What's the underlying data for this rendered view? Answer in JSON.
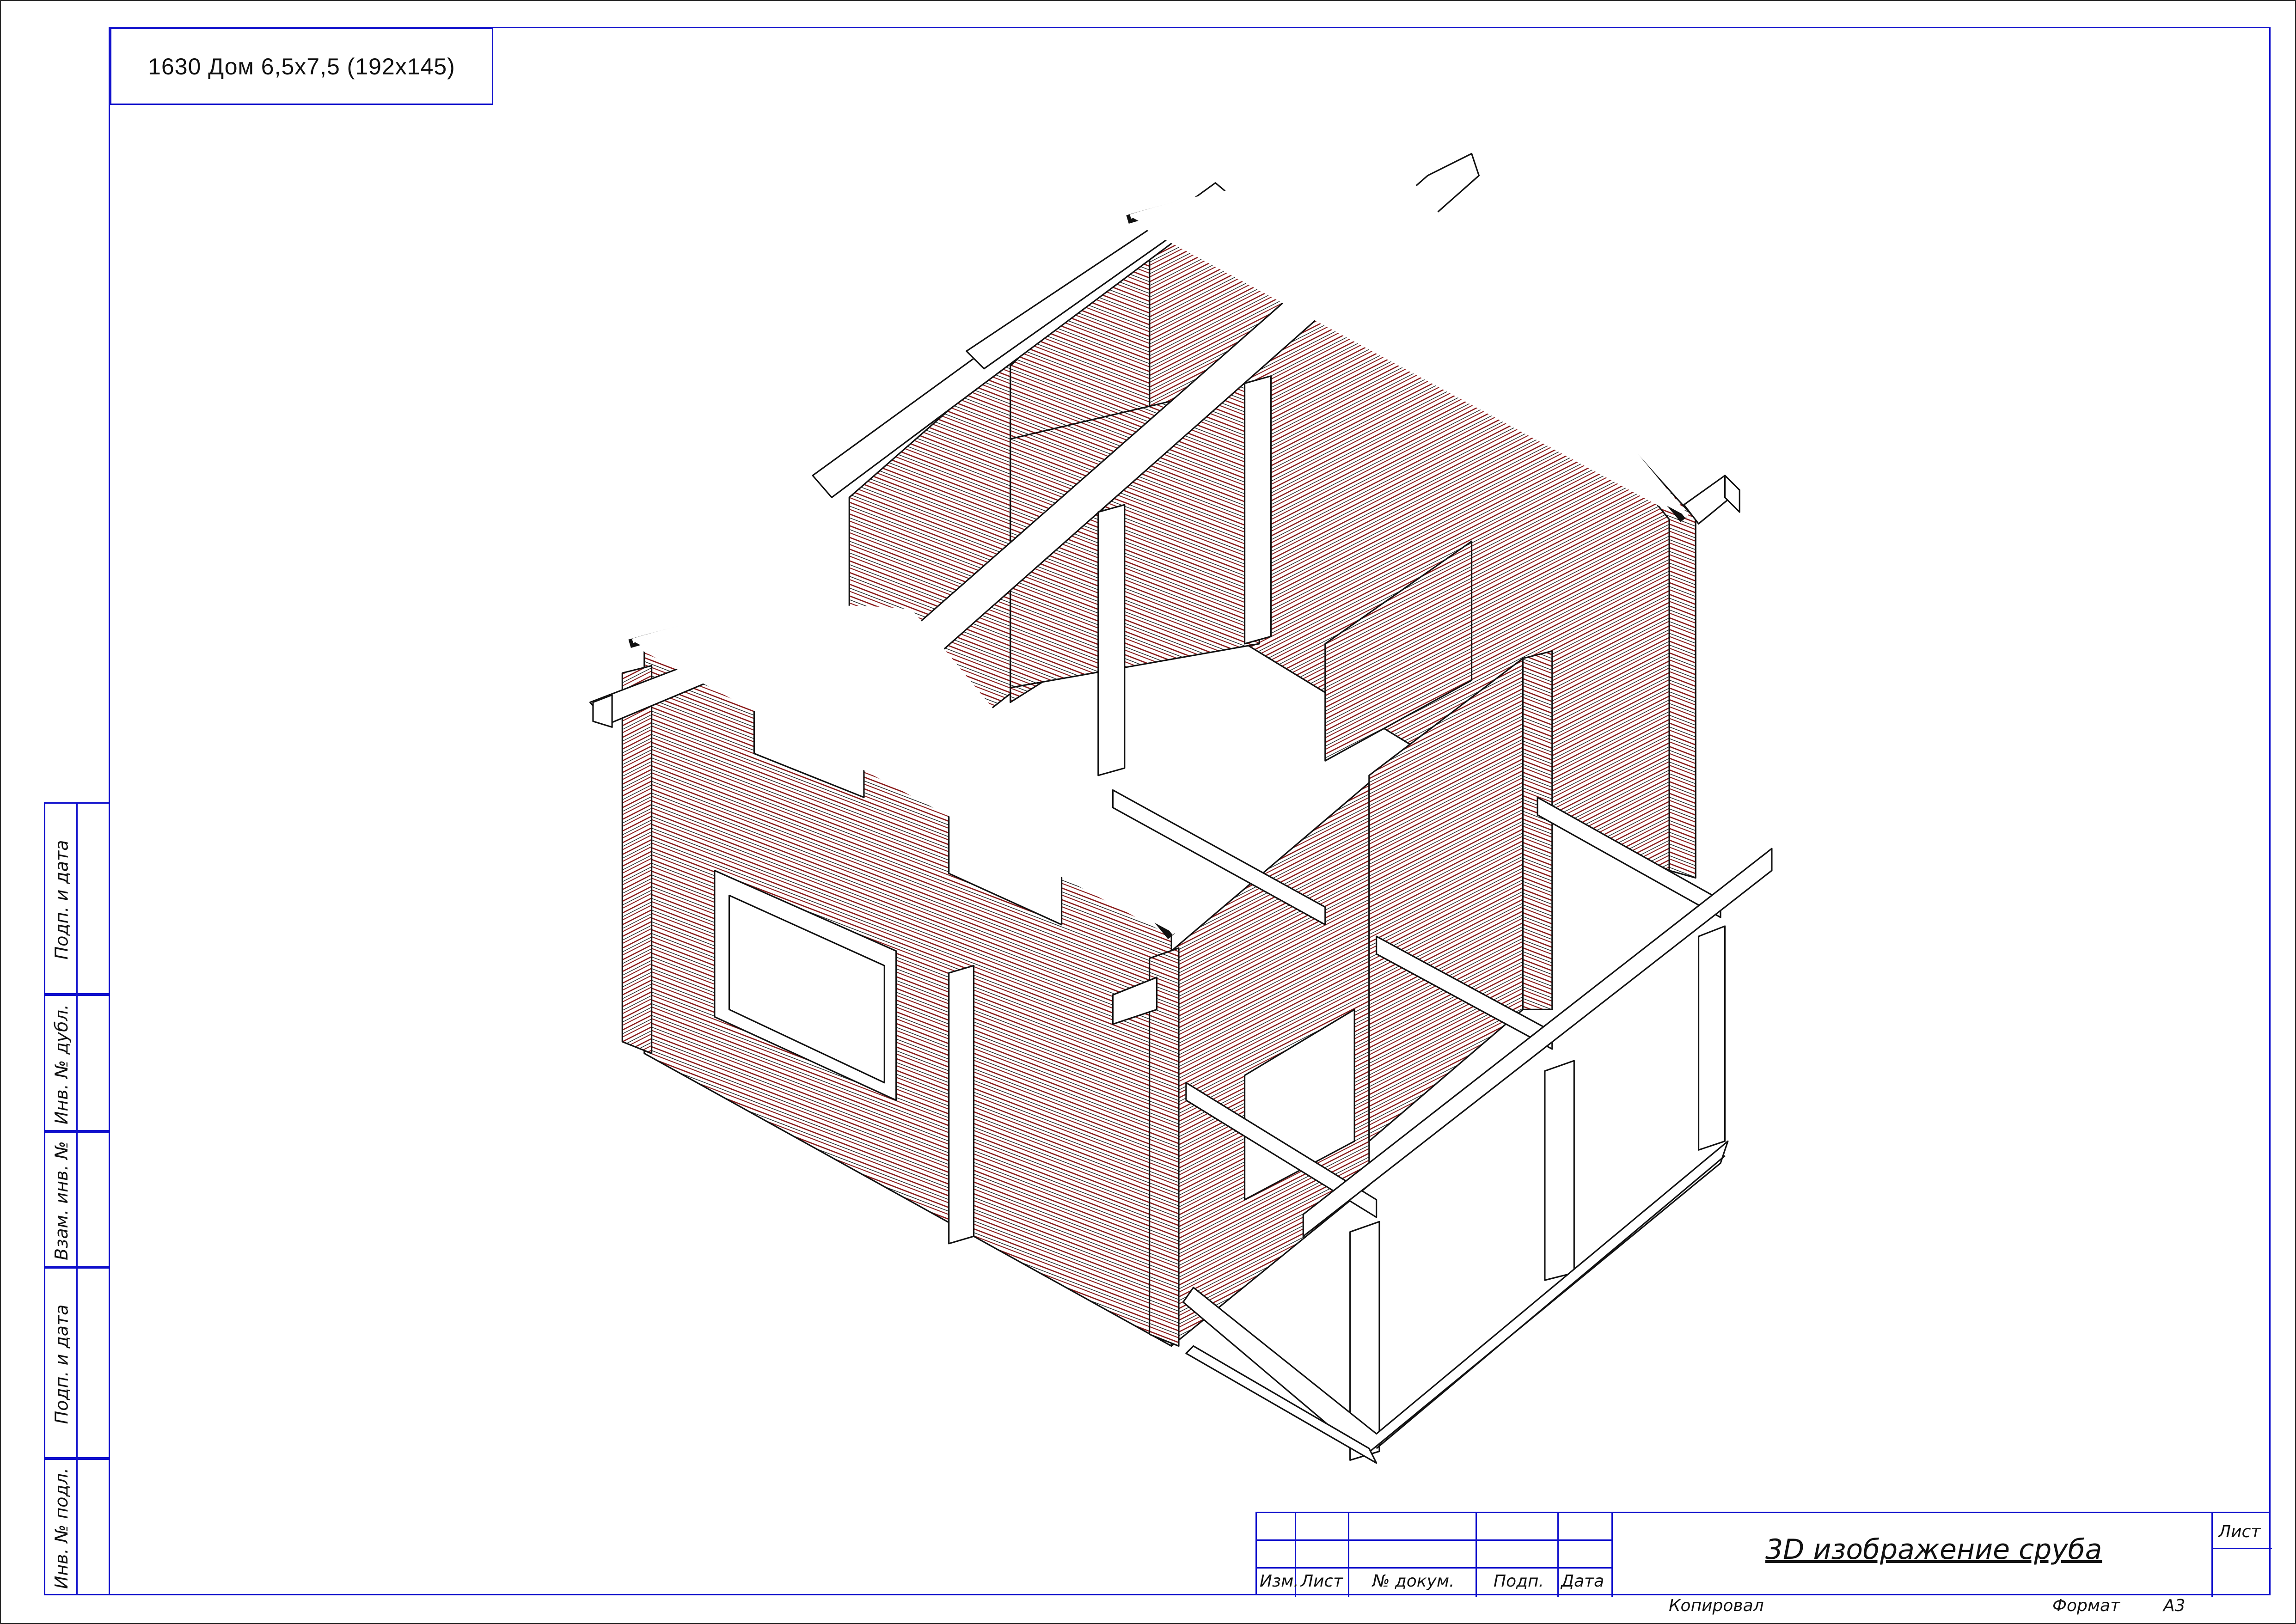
{
  "drawing_code": "1630 Дом 6,5x7,5 (192x145)",
  "side_stamp": {
    "cells": [
      "Подп. и дата",
      "Инв. № дубл.",
      "Взам. инв. №",
      "Подп. и дата",
      "Инв. № подл."
    ]
  },
  "title_block": {
    "columns": [
      "Изм.",
      "Лист",
      "№ докум.",
      "Подп.",
      "Дата"
    ],
    "document_title": "3D изображение сруба",
    "sheet_label": "Лист"
  },
  "footer": {
    "copied_label": "Копировал",
    "format_label": "Формат",
    "format_value": "А3"
  },
  "colors": {
    "frame": "#1010cc",
    "drawing_line": "#111111",
    "log_hatch": "#8a1a1a"
  }
}
